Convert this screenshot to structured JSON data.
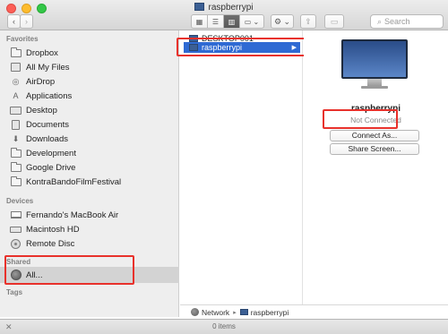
{
  "window": {
    "title": "raspberrypi"
  },
  "toolbar": {
    "back_icon": "‹",
    "forward_icon": "›",
    "view_icons": [
      "▦",
      "☰",
      "▥",
      "▭ ⌄"
    ],
    "action_icon": "⚙ ⌄",
    "share_icon": "⇪",
    "tag_icon": "▭",
    "search_icon": "⌕",
    "search_placeholder": "Search"
  },
  "sidebar": {
    "favorites_heading": "Favorites",
    "favorites": [
      {
        "label": "Dropbox",
        "icon": "folder-icon"
      },
      {
        "label": "All My Files",
        "icon": "files-icon"
      },
      {
        "label": "AirDrop",
        "icon": "airdrop-icon"
      },
      {
        "label": "Applications",
        "icon": "applications-icon"
      },
      {
        "label": "Desktop",
        "icon": "desktop-icon"
      },
      {
        "label": "Documents",
        "icon": "documents-icon"
      },
      {
        "label": "Downloads",
        "icon": "downloads-icon"
      },
      {
        "label": "Development",
        "icon": "folder-icon"
      },
      {
        "label": "Google Drive",
        "icon": "folder-icon"
      },
      {
        "label": "KontraBandoFilmFestival",
        "icon": "folder-icon"
      }
    ],
    "devices_heading": "Devices",
    "devices": [
      {
        "label": "Fernando's MacBook Air",
        "icon": "laptop-icon"
      },
      {
        "label": "Macintosh HD",
        "icon": "drive-icon"
      },
      {
        "label": "Remote Disc",
        "icon": "disc-icon"
      }
    ],
    "shared_heading": "Shared",
    "shared": [
      {
        "label": "All...",
        "icon": "network-globe-icon"
      }
    ],
    "tags_heading": "Tags"
  },
  "column1": {
    "items": [
      {
        "label": "DESKTOP001"
      },
      {
        "label": "raspberrypi",
        "arrow": "▶"
      }
    ]
  },
  "preview": {
    "name": "raspberrypi",
    "status": "Not Connected",
    "connect_button": "Connect As...",
    "share_screen_button": "Share Screen..."
  },
  "pathbar": {
    "network": "Network",
    "separator": "▸",
    "computer": "raspberrypi"
  },
  "statusbar": {
    "close_icon": "✕",
    "item_count": "0 items"
  },
  "colors": {
    "selection": "#2f6ad3",
    "highlight_box": "#e8312b",
    "sidebar_bg": "#eeeeee"
  }
}
